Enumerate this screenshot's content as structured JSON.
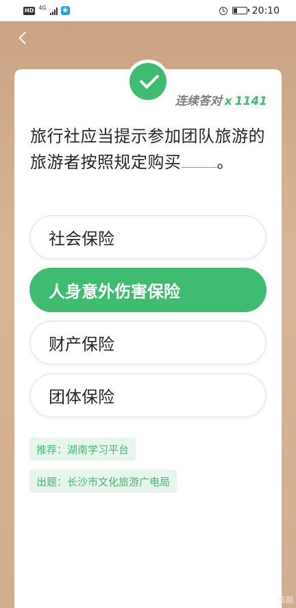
{
  "status_bar": {
    "hd_label": "HD",
    "network_label": "4G",
    "app_icon_glyph": "◉",
    "time": "20:10",
    "battery_fill_fraction": 0.3
  },
  "nav": {
    "back_icon": "chevron-left-icon"
  },
  "streak": {
    "label": "连续答对",
    "multiplier": "x",
    "count": "1141"
  },
  "question": {
    "text_before": "旅行社应当提示参加团队旅游的旅游者按照规定购买",
    "text_after": "。"
  },
  "options": [
    {
      "label": "社会保险",
      "selected": false
    },
    {
      "label": "人身意外伤害保险",
      "selected": true
    },
    {
      "label": "财产保险",
      "selected": false
    },
    {
      "label": "团体保险",
      "selected": false
    }
  ],
  "tags": {
    "recommend": "推荐：湖南学习平台",
    "source": "出题：长沙市文化旅游广电局"
  },
  "corner_text": "答题",
  "colors": {
    "accent": "#3fbc72",
    "background": "#d2ad8f",
    "tag_bg": "#e7f5ec"
  }
}
